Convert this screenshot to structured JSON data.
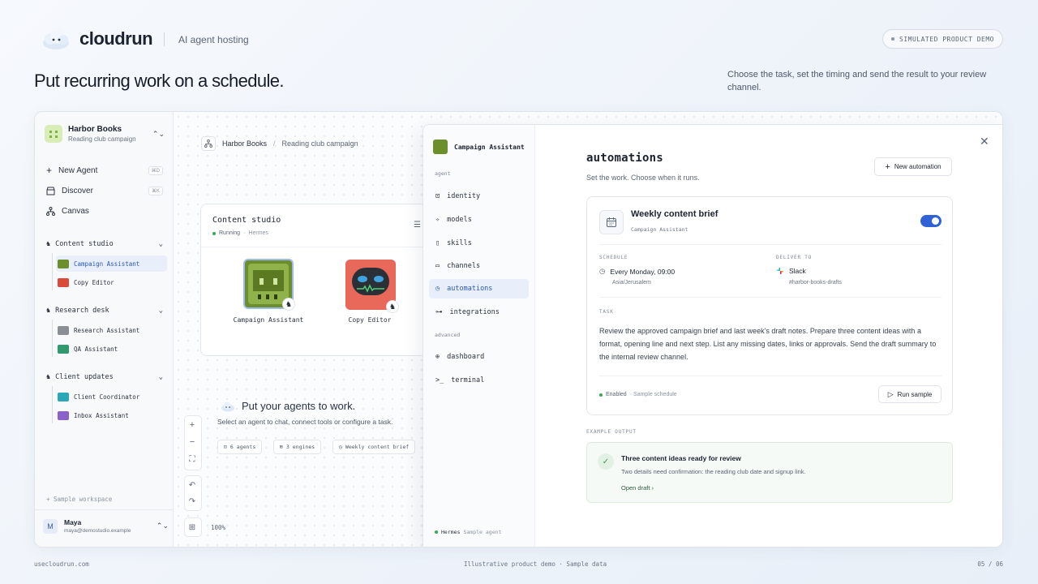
{
  "brand": {
    "name": "cloudrun",
    "tagline": "AI agent hosting",
    "pill": "SIMULATED PRODUCT DEMO"
  },
  "hero": {
    "headline": "Put recurring work on a schedule.",
    "subhead": "Choose the task, set the timing and send the result to your review channel."
  },
  "sidebar": {
    "workspace": {
      "name": "Harbor Books",
      "sub": "Reading club campaign"
    },
    "nav": [
      {
        "label": "New Agent",
        "kbd": "⌘D"
      },
      {
        "label": "Discover",
        "kbd": "⌘K"
      },
      {
        "label": "Canvas"
      }
    ],
    "groups": [
      {
        "label": "Content studio",
        "items": [
          "Campaign Assistant",
          "Copy Editor"
        ]
      },
      {
        "label": "Research desk",
        "items": [
          "Research Assistant",
          "QA Assistant"
        ]
      },
      {
        "label": "Client updates",
        "items": [
          "Client Coordinator",
          "Inbox Assistant"
        ]
      }
    ],
    "sample": "Sample workspace",
    "user": {
      "initial": "M",
      "name": "Maya",
      "email": "maya@demostudio.example"
    }
  },
  "canvas": {
    "breadcrumb": [
      "Harbor Books",
      "Reading club campaign"
    ],
    "card": {
      "title": "Content studio",
      "status": "Running",
      "engine": "Hermes",
      "agents": [
        "Campaign Assistant",
        "Copy Editor"
      ]
    },
    "empty": {
      "title": "Put your agents to work.",
      "sub": "Select an agent to chat, connect tools or configure a task."
    },
    "chips": [
      "6 agents",
      "3 engines",
      "Weekly content brief"
    ],
    "zoom": "100%"
  },
  "modal": {
    "agent": "Campaign Assistant",
    "section_agent": "agent",
    "section_advanced": "advanced",
    "nav": [
      "identity",
      "models",
      "skills",
      "channels",
      "automations",
      "integrations"
    ],
    "nav_adv": [
      "dashboard",
      "terminal"
    ],
    "footer": {
      "engine": "Hermes",
      "note": "Sample agent"
    },
    "title": "automations",
    "subtitle": "Set the work. Choose when it runs.",
    "new_button": "New automation",
    "automation": {
      "name": "Weekly content brief",
      "agent": "Campaign Assistant",
      "enabled": true,
      "schedule_label": "SCHEDULE",
      "schedule": "Every Monday, 09:00",
      "timezone": "Asia/Jerusalem",
      "deliver_label": "DELIVER TO",
      "deliver": "Slack",
      "channel": "#harbor-books-drafts",
      "task_label": "TASK",
      "task": "Review the approved campaign brief and last week's draft notes. Prepare three content ideas with a format, opening line and next step. List any missing dates, links or approvals. Send the draft summary to the internal review channel.",
      "status": "Enabled",
      "status_note": "· Sample schedule",
      "run_button": "Run sample"
    },
    "example": {
      "label": "EXAMPLE OUTPUT",
      "title": "Three content ideas ready for review",
      "sub": "Two details need confirmation: the reading club date and signup link.",
      "link": "Open draft"
    }
  },
  "footer": {
    "left": "usecloudrun.com",
    "center": "Illustrative product demo · Sample data",
    "right": "05 / 06"
  },
  "colors": {
    "accent": "#2f62d6",
    "success": "#3aa55a",
    "active_bg": "#e8effb"
  }
}
